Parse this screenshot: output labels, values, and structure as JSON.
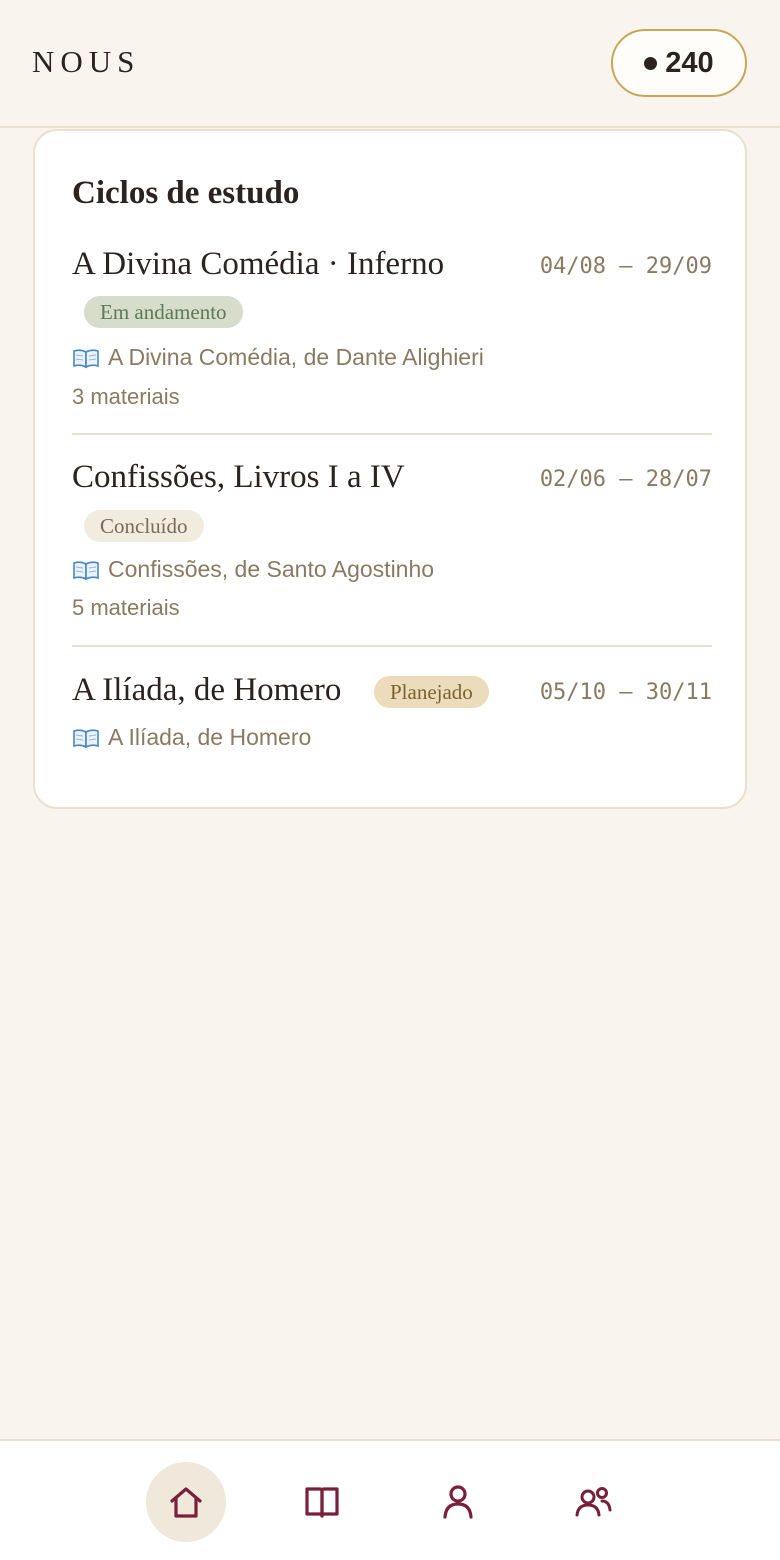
{
  "header": {
    "logo": "NOUS",
    "points": "240"
  },
  "card": {
    "title": "Ciclos de estudo",
    "cycles": [
      {
        "name": "A Divina Comédia · Inferno",
        "dates": "04/08 – 29/09",
        "status": "Em andamento",
        "source": "A Divina Comédia, de Dante Alighieri",
        "materials": "3 materiais"
      },
      {
        "name": "Confissões, Livros I a IV",
        "dates": "02/06 – 28/07",
        "status": "Concluído",
        "source": "Confissões, de Santo Agostinho",
        "materials": "5 materiais"
      },
      {
        "name": "A Ilíada, de Homero",
        "dates": "05/10 – 30/11",
        "status": "Planejado",
        "source": "A Ilíada, de Homero"
      }
    ]
  },
  "nav": {
    "items": [
      {
        "icon": "home-icon",
        "active": true
      },
      {
        "icon": "book-open-icon",
        "active": false
      },
      {
        "icon": "user-icon",
        "active": false
      },
      {
        "icon": "users-icon",
        "active": false
      }
    ]
  },
  "colors": {
    "background": "#f9f5ee",
    "accent": "#7a1e3a",
    "gold": "#c8a659",
    "text": "#2a2320",
    "muted": "#8a7a63"
  }
}
